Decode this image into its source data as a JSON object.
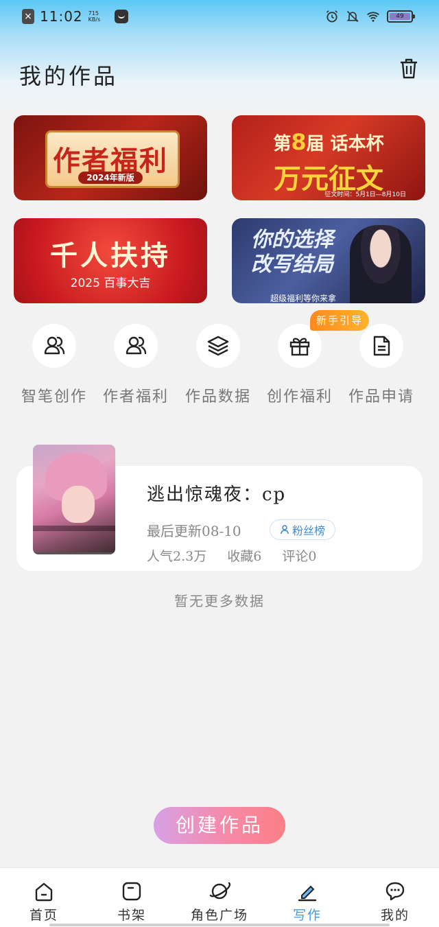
{
  "status_bar": {
    "time": "11:02",
    "net_speed": "715 KB/s",
    "battery": "49",
    "icons": [
      "close-notification-icon",
      "app-icon",
      "alarm-icon",
      "mute-icon",
      "wifi-icon",
      "battery-icon"
    ]
  },
  "header": {
    "title": "我的作品",
    "trash_icon": "trash-icon"
  },
  "banners": [
    {
      "title": "作者福利",
      "subtitle": "2024年新版"
    },
    {
      "line1_prefix": "第",
      "line1_num": "8",
      "line1_mid": "届",
      "line1_suffix": "话本杯",
      "title": "万元征文",
      "note": "征文时间：5月1日—8月10日"
    },
    {
      "title": "千人扶持",
      "subtitle": "2025 百事大吉"
    },
    {
      "title_l1": "你的选择",
      "title_l2": "改写结局",
      "subtitle": "超级福利等你来拿"
    }
  ],
  "quick_actions": [
    {
      "label": "智笔创作",
      "icon": "users-icon"
    },
    {
      "label": "作者福利",
      "icon": "users-icon"
    },
    {
      "label": "作品数据",
      "icon": "layers-icon"
    },
    {
      "label": "创作福利",
      "icon": "gift-icon"
    },
    {
      "label": "作品申请",
      "icon": "document-icon"
    }
  ],
  "guide_badge": "新手引导",
  "work": {
    "title": "逃出惊魂夜：cp",
    "updated": "最后更新08-10",
    "badge": "粉丝榜",
    "popularity": "人气2.3万",
    "favorites": "收藏6",
    "comments": "评论0"
  },
  "no_more": "暂无更多数据",
  "create_button": "创建作品",
  "bottom_nav": [
    {
      "label": "首页",
      "icon": "home-icon"
    },
    {
      "label": "书架",
      "icon": "bookshelf-icon"
    },
    {
      "label": "角色广场",
      "icon": "planet-icon"
    },
    {
      "label": "写作",
      "icon": "pen-icon",
      "active": true
    },
    {
      "label": "我的",
      "icon": "chat-bubble-icon"
    }
  ],
  "colors": {
    "accent": "#3d9be9",
    "create_gradient_start": "#d7a1e6",
    "create_gradient_end": "#fb7f86",
    "guide_badge": "#ff9a24"
  }
}
